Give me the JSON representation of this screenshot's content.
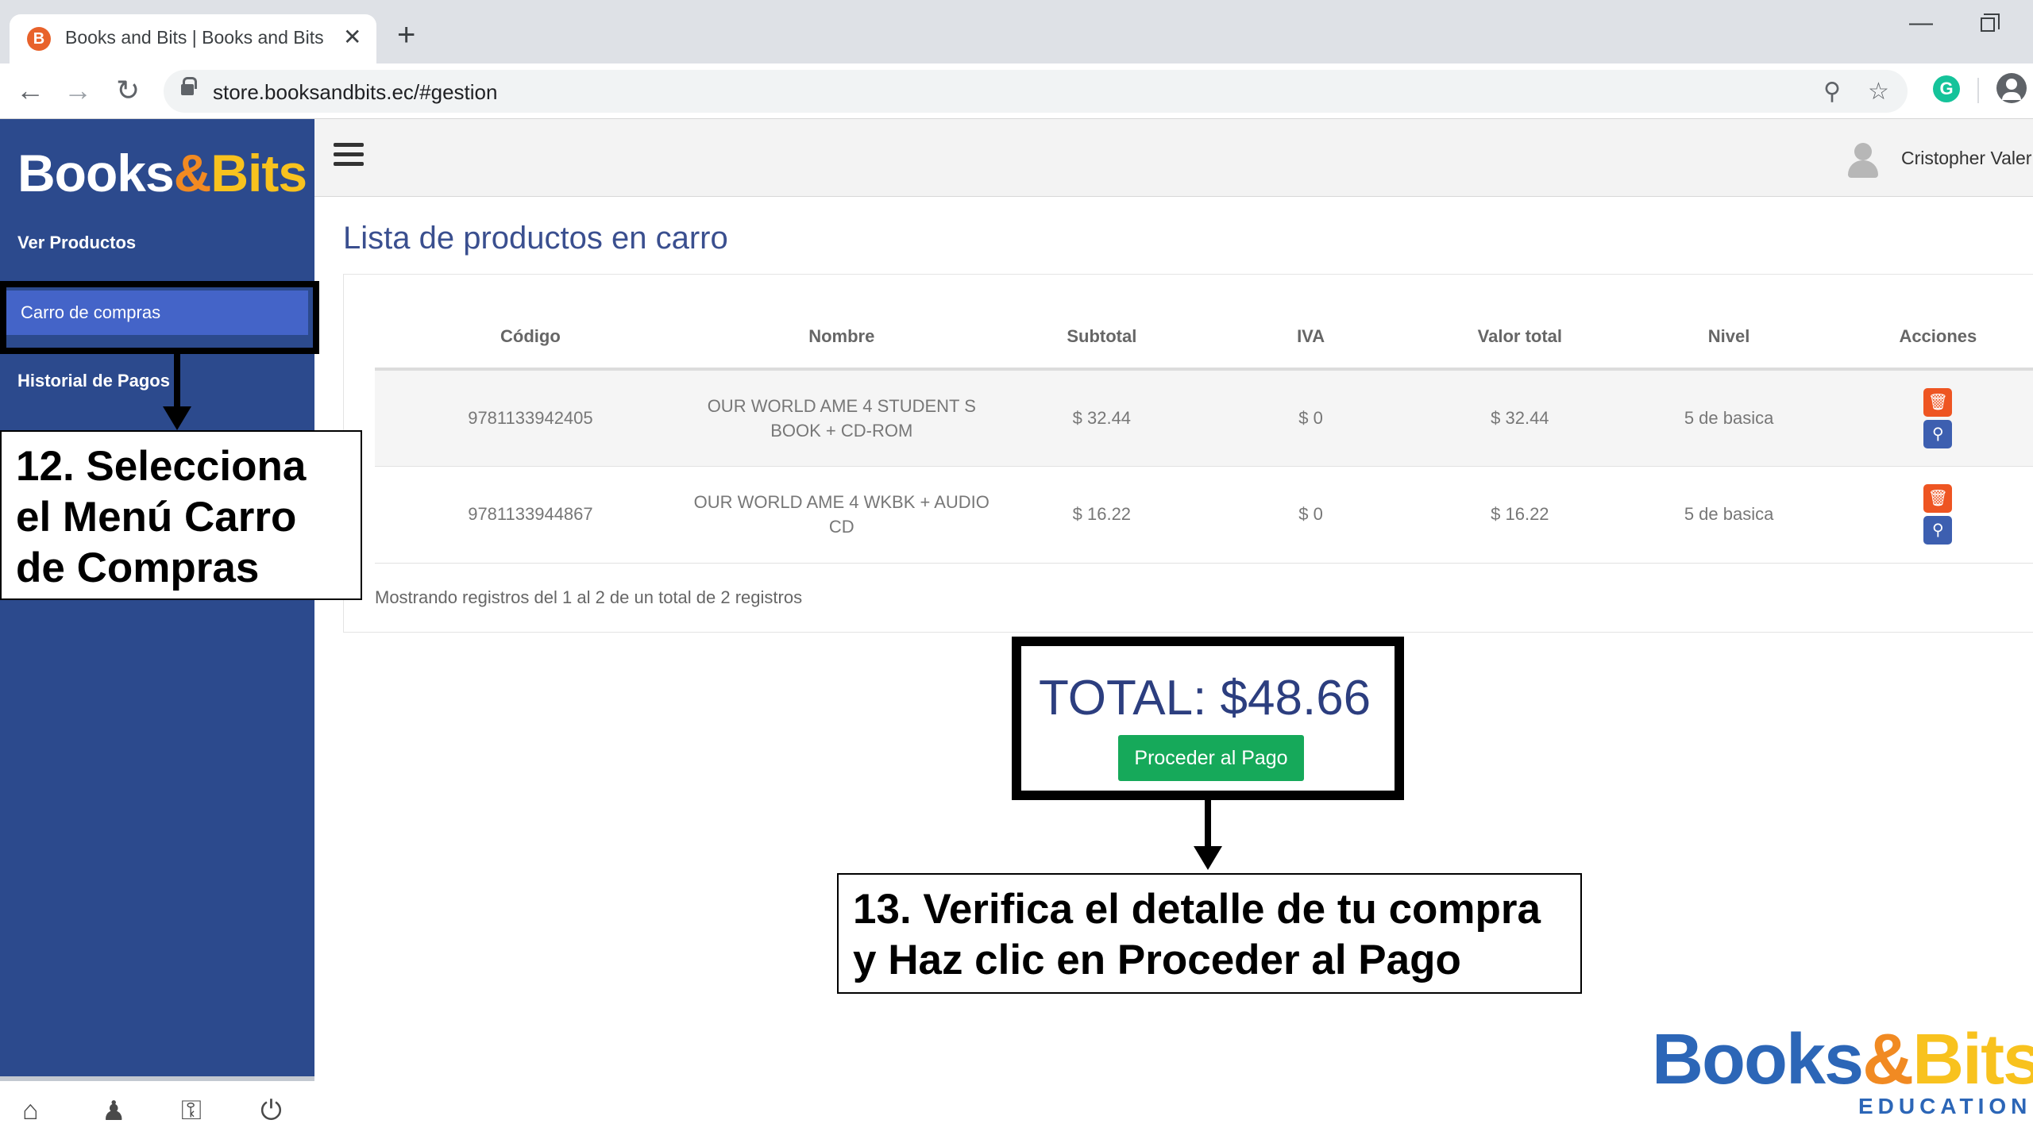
{
  "browser": {
    "tab_title": "Books and Bits | Books and Bits",
    "tab_close": "✕",
    "new_tab": "+",
    "url": "store.booksandbits.ec/#gestion",
    "min_glyph": "—"
  },
  "sidebar": {
    "logo_books": "Books",
    "logo_amp": "&",
    "logo_bits": "Bits",
    "items": [
      {
        "label": "Ver Productos"
      },
      {
        "label": "Carro de compras"
      },
      {
        "label": "Historial de Pagos"
      }
    ],
    "footer_icons": [
      "home-icon",
      "user-icon",
      "key-icon",
      "power-icon"
    ]
  },
  "header": {
    "user_name": "Cristopher Valer"
  },
  "main": {
    "title": "Lista de productos en carro",
    "columns": [
      "Código",
      "Nombre",
      "Subtotal",
      "IVA",
      "Valor total",
      "Nivel",
      "Acciones"
    ],
    "rows": [
      {
        "code": "9781133942405",
        "name": "OUR WORLD AME 4 STUDENT S BOOK + CD-ROM",
        "subtotal": "$ 32.44",
        "iva": "$ 0",
        "total": "$ 32.44",
        "level": "5 de basica"
      },
      {
        "code": "9781133944867",
        "name": "OUR WORLD AME 4 WKBK + AUDIO CD",
        "subtotal": "$ 16.22",
        "iva": "$ 0",
        "total": "$ 16.22",
        "level": "5 de basica"
      }
    ],
    "records_note": "Mostrando registros del 1 al 2 de un total de 2 registros",
    "total_label": "TOTAL: $48.66",
    "pay_button": "Proceder al Pago"
  },
  "annotations": {
    "step12": "12. Selecciona el Menú Carro de Compras",
    "step13": "13. Verifica el detalle de tu compra y Haz clic en Proceder al Pago"
  },
  "brand": {
    "b1": "Books",
    "amp": "&",
    "b2": "Bits",
    "sub": "EDUCATION"
  },
  "colors": {
    "sidebar": "#2c4a8d",
    "active_item": "#4464c8",
    "title": "#3a4f8f",
    "pay_button": "#16a95a",
    "delete": "#ee5522",
    "view": "#3d5fb0"
  }
}
